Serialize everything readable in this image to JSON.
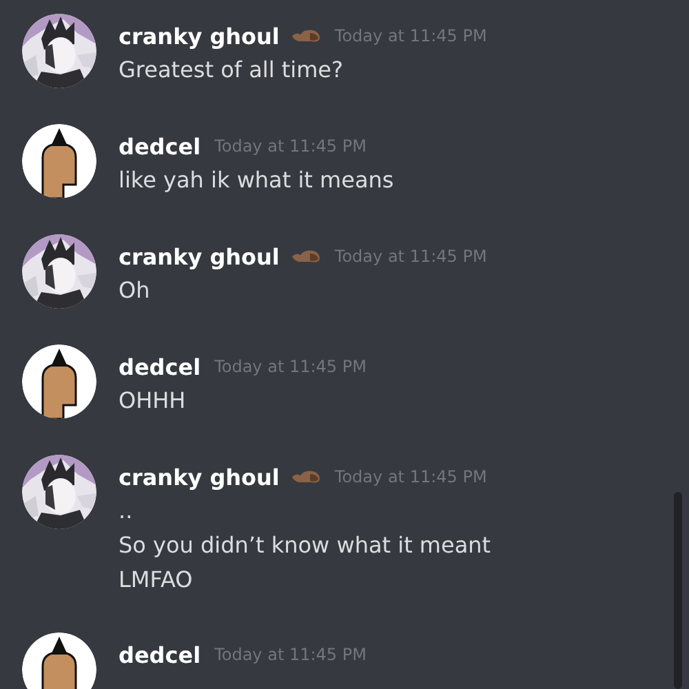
{
  "messages": [
    {
      "author": "cranky ghoul",
      "kind": "ghoul",
      "badge": true,
      "time": "Today at 11:45 PM",
      "lines": [
        "Greatest of all time?"
      ]
    },
    {
      "author": "dedcel",
      "kind": "mohawk",
      "badge": false,
      "time": "Today at 11:45 PM",
      "lines": [
        "like yah ik what it means"
      ]
    },
    {
      "author": "cranky ghoul",
      "kind": "ghoul",
      "badge": true,
      "time": "Today at 11:45 PM",
      "lines": [
        "Oh"
      ]
    },
    {
      "author": "dedcel",
      "kind": "mohawk",
      "badge": false,
      "time": "Today at 11:45 PM",
      "lines": [
        "OHHH"
      ]
    },
    {
      "author": "cranky ghoul",
      "kind": "ghoul",
      "badge": true,
      "time": "Today at 11:45 PM",
      "lines": [
        "..",
        "So you didn’t know what it meant",
        "LMFAO"
      ]
    },
    {
      "author": "dedcel",
      "kind": "mohawk",
      "badge": false,
      "time": "Today at 11:45 PM"
    }
  ]
}
